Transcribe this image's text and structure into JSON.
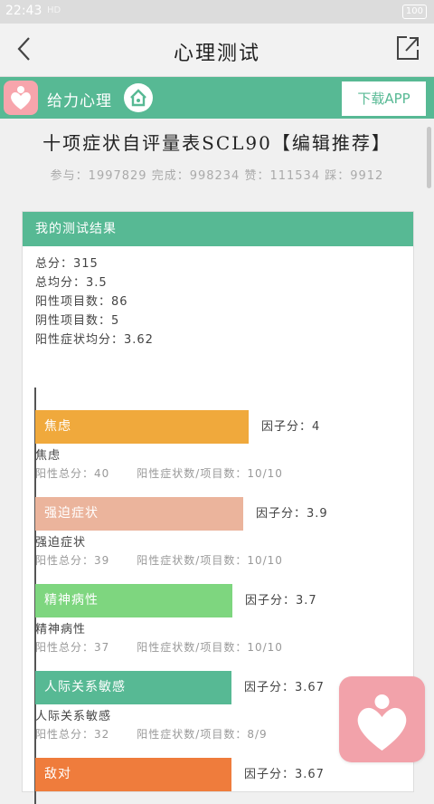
{
  "status_bar": {
    "time": "22:43",
    "network": "HD",
    "battery": "100"
  },
  "nav": {
    "title": "心理测试"
  },
  "banner": {
    "brand": "给力心理",
    "download_label": "下载APP",
    "accent": "#57b994"
  },
  "scale": {
    "title": "十项症状自评量表SCL90【编辑推荐】",
    "stats": "参与：1997829 完成：998234 赞：111534 踩：9912"
  },
  "result": {
    "header": "我的测试结果",
    "summary": [
      "总分：315",
      "总均分：3.5",
      "阳性项目数：86",
      "阴性项目数：5",
      "阳性症状均分：3.62"
    ]
  },
  "chart_data": {
    "type": "bar",
    "orientation": "horizontal",
    "max": 4,
    "categories": [
      "焦虑",
      "强迫症状",
      "精神病性",
      "人际关系敏感",
      "敌对"
    ],
    "values": [
      4,
      3.9,
      3.7,
      3.67,
      3.67
    ],
    "colors": [
      "#f0a93c",
      "#ebb49c",
      "#7ed67f",
      "#57b994",
      "#ef7c3c"
    ]
  },
  "factors": [
    {
      "bar_label": "焦虑",
      "color": "#f0a93c",
      "score_label": "因子分：4",
      "value": 4,
      "name": "焦虑",
      "pos_total": "阳性总分：40",
      "pos_count": "阳性症状数/项目数：10/10"
    },
    {
      "bar_label": "强迫症状",
      "color": "#ebb49c",
      "score_label": "因子分：3.9",
      "value": 3.9,
      "name": "强迫症状",
      "pos_total": "阳性总分：39",
      "pos_count": "阳性症状数/项目数：10/10"
    },
    {
      "bar_label": "精神病性",
      "color": "#7ed67f",
      "score_label": "因子分：3.7",
      "value": 3.7,
      "name": "精神病性",
      "pos_total": "阳性总分：37",
      "pos_count": "阳性症状数/项目数：10/10"
    },
    {
      "bar_label": "人际关系敏感",
      "color": "#57b994",
      "score_label": "因子分：3.67",
      "value": 3.67,
      "name": "人际关系敏感",
      "pos_total": "阳性总分：32",
      "pos_count": "阳性症状数/项目数：8/9"
    },
    {
      "bar_label": "敌对",
      "color": "#ef7c3c",
      "score_label": "因子分：3.67",
      "value": 3.67,
      "name": "",
      "pos_total": "",
      "pos_count": ""
    }
  ]
}
